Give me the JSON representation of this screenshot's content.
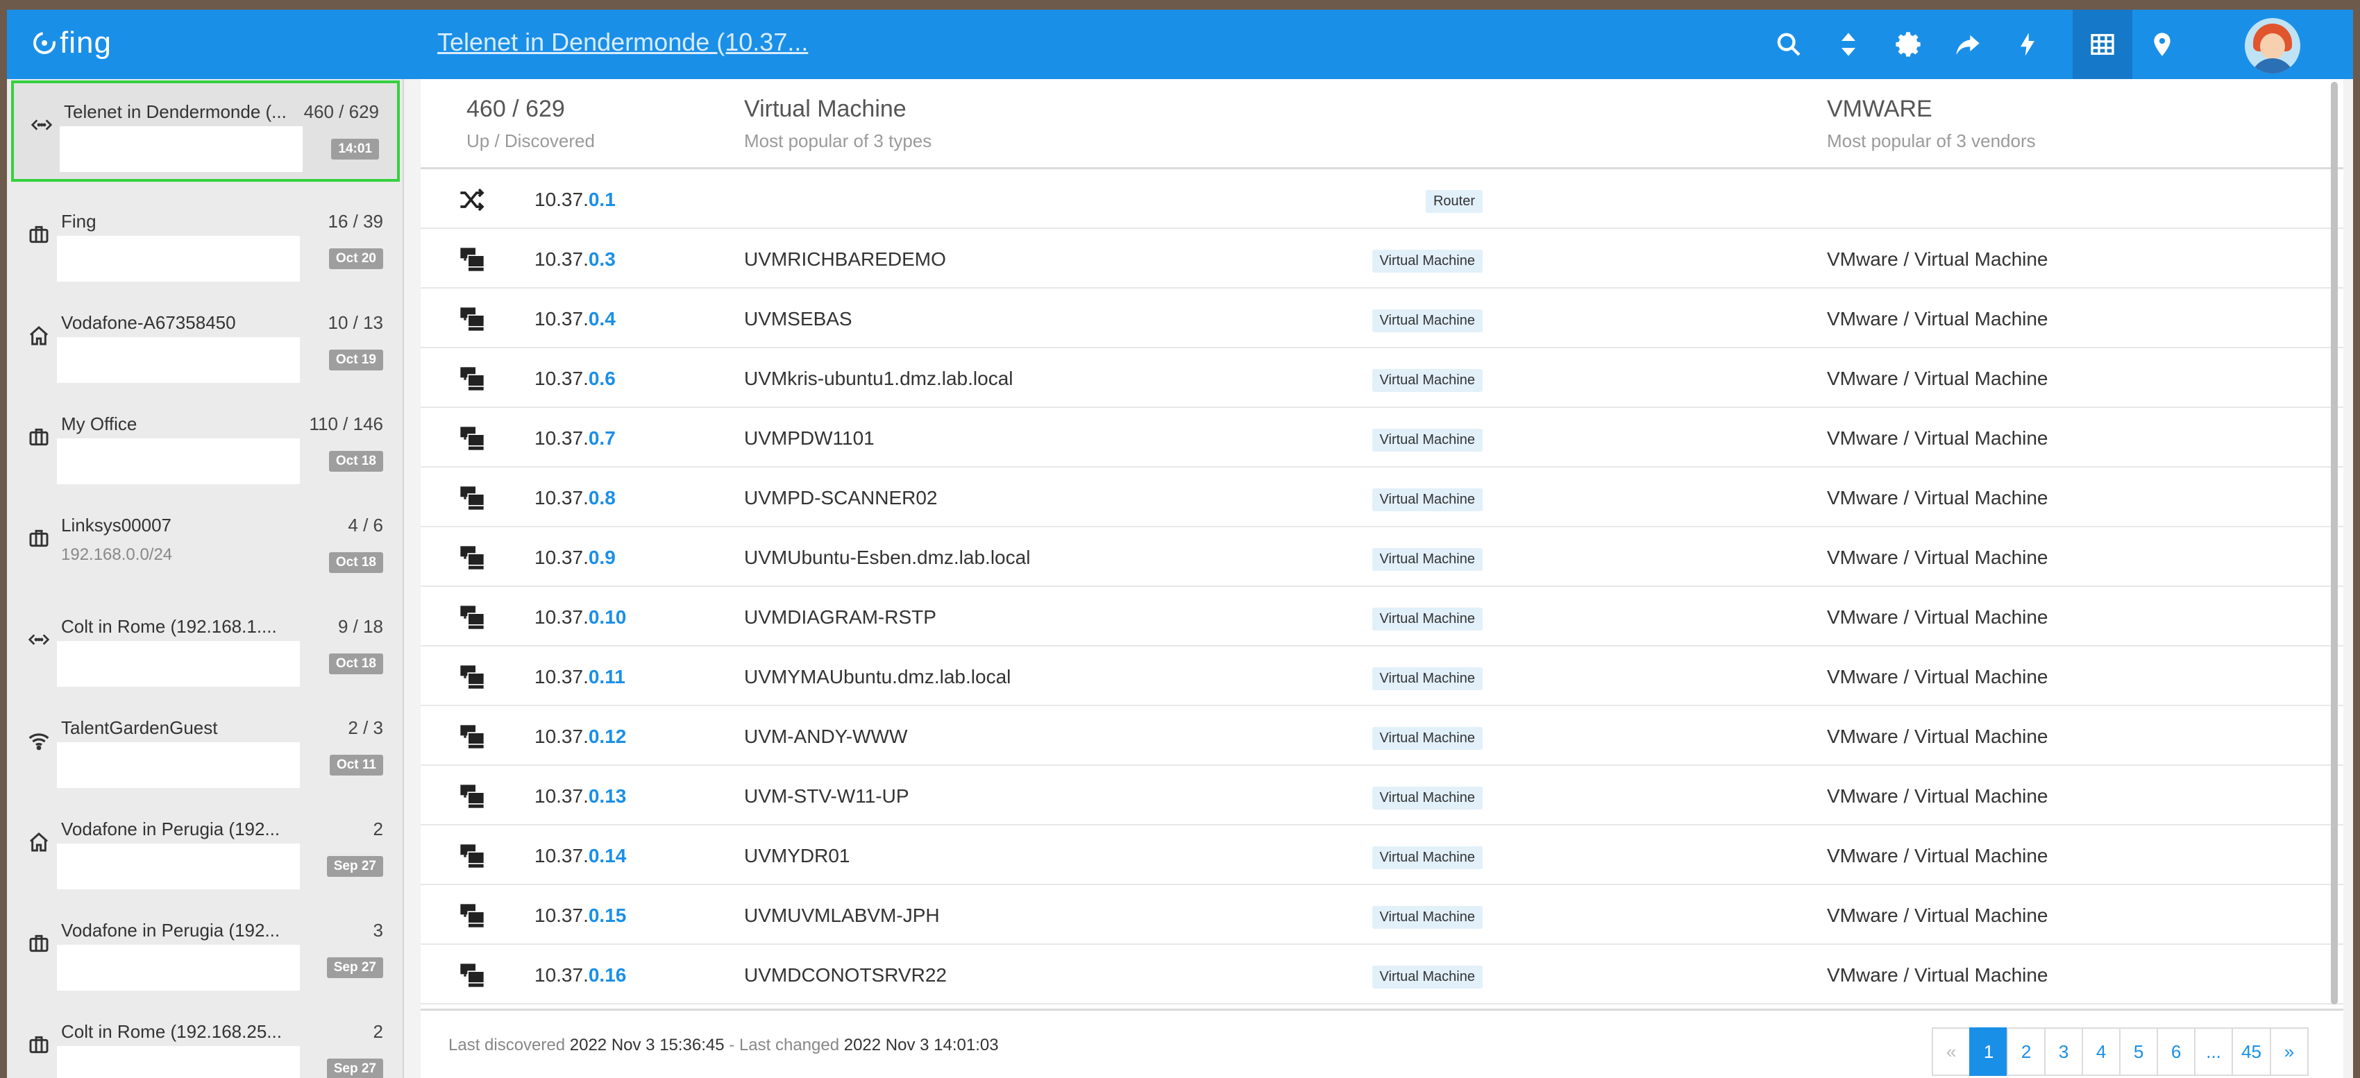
{
  "app": {
    "logo_text": "fing",
    "network_title": "Telenet in Dendermonde (10.37..."
  },
  "toolbar": {
    "search": "search-icon",
    "sort": "sort-icon",
    "settings": "gear-icon",
    "share": "share-icon",
    "bolt": "bolt-icon",
    "grid": "grid-icon",
    "location": "location-pin-icon"
  },
  "sidebar": {
    "items": [
      {
        "name": "Telenet in Dendermonde (...",
        "count": "460 / 629",
        "sub": "",
        "date": "14:01",
        "icon": "ethernet"
      },
      {
        "name": "Fing",
        "count": "16 / 39",
        "sub": "",
        "date": "Oct 20",
        "icon": "briefcase"
      },
      {
        "name": "Vodafone-A67358450",
        "count": "10 / 13",
        "sub": "",
        "date": "Oct 19",
        "icon": "home"
      },
      {
        "name": "My Office",
        "count": "110 / 146",
        "sub": "",
        "date": "Oct 18",
        "icon": "briefcase"
      },
      {
        "name": "Linksys00007",
        "count": "4 / 6",
        "sub": "192.168.0.0/24",
        "date": "Oct 18",
        "icon": "briefcase"
      },
      {
        "name": "Colt in Rome (192.168.1....",
        "count": "9 / 18",
        "sub": "",
        "date": "Oct 18",
        "icon": "ethernet"
      },
      {
        "name": "TalentGardenGuest",
        "count": "2 / 3",
        "sub": "",
        "date": "Oct 11",
        "icon": "wifi"
      },
      {
        "name": "Vodafone in Perugia (192...",
        "count": "2",
        "sub": "",
        "date": "Sep 27",
        "icon": "home"
      },
      {
        "name": "Vodafone in Perugia (192...",
        "count": "3",
        "sub": "",
        "date": "Sep 27",
        "icon": "briefcase"
      },
      {
        "name": "Colt in Rome (192.168.25...",
        "count": "2",
        "sub": "",
        "date": "Sep 27",
        "icon": "briefcase"
      }
    ]
  },
  "summary": {
    "devices_value": "460 / 629",
    "devices_label": "Up / Discovered",
    "type_value": "Virtual Machine",
    "type_label": "Most popular of 3 types",
    "vendor_value": "VMWARE",
    "vendor_label": "Most popular of 3 vendors"
  },
  "devices": [
    {
      "ip_prefix": "10.37.",
      "ip_host": "0.1",
      "name": "",
      "type": "Router",
      "vendor": "",
      "icon": "router"
    },
    {
      "ip_prefix": "10.37.",
      "ip_host": "0.3",
      "name": "UVMRICHBAREDEMO",
      "type": "Virtual Machine",
      "vendor": "VMware / Virtual Machine",
      "icon": "vm"
    },
    {
      "ip_prefix": "10.37.",
      "ip_host": "0.4",
      "name": "UVMSEBAS",
      "type": "Virtual Machine",
      "vendor": "VMware / Virtual Machine",
      "icon": "vm"
    },
    {
      "ip_prefix": "10.37.",
      "ip_host": "0.6",
      "name": "UVMkris-ubuntu1.dmz.lab.local",
      "type": "Virtual Machine",
      "vendor": "VMware / Virtual Machine",
      "icon": "vm"
    },
    {
      "ip_prefix": "10.37.",
      "ip_host": "0.7",
      "name": "UVMPDW1101",
      "type": "Virtual Machine",
      "vendor": "VMware / Virtual Machine",
      "icon": "vm"
    },
    {
      "ip_prefix": "10.37.",
      "ip_host": "0.8",
      "name": "UVMPD-SCANNER02",
      "type": "Virtual Machine",
      "vendor": "VMware / Virtual Machine",
      "icon": "vm"
    },
    {
      "ip_prefix": "10.37.",
      "ip_host": "0.9",
      "name": "UVMUbuntu-Esben.dmz.lab.local",
      "type": "Virtual Machine",
      "vendor": "VMware / Virtual Machine",
      "icon": "vm"
    },
    {
      "ip_prefix": "10.37.",
      "ip_host": "0.10",
      "name": "UVMDIAGRAM-RSTP",
      "type": "Virtual Machine",
      "vendor": "VMware / Virtual Machine",
      "icon": "vm"
    },
    {
      "ip_prefix": "10.37.",
      "ip_host": "0.11",
      "name": "UVMYMAUbuntu.dmz.lab.local",
      "type": "Virtual Machine",
      "vendor": "VMware / Virtual Machine",
      "icon": "vm"
    },
    {
      "ip_prefix": "10.37.",
      "ip_host": "0.12",
      "name": "UVM-ANDY-WWW",
      "type": "Virtual Machine",
      "vendor": "VMware / Virtual Machine",
      "icon": "vm"
    },
    {
      "ip_prefix": "10.37.",
      "ip_host": "0.13",
      "name": "UVM-STV-W11-UP",
      "type": "Virtual Machine",
      "vendor": "VMware / Virtual Machine",
      "icon": "vm"
    },
    {
      "ip_prefix": "10.37.",
      "ip_host": "0.14",
      "name": "UVMYDR01",
      "type": "Virtual Machine",
      "vendor": "VMware / Virtual Machine",
      "icon": "vm"
    },
    {
      "ip_prefix": "10.37.",
      "ip_host": "0.15",
      "name": "UVMUVMLABVM-JPH",
      "type": "Virtual Machine",
      "vendor": "VMware / Virtual Machine",
      "icon": "vm"
    },
    {
      "ip_prefix": "10.37.",
      "ip_host": "0.16",
      "name": "UVMDCONOTSRVR22",
      "type": "Virtual Machine",
      "vendor": "VMware / Virtual Machine",
      "icon": "vm"
    }
  ],
  "footer": {
    "last_discovered_label": "Last discovered",
    "last_discovered_value": "2022 Nov 3 15:36:45",
    "separator": " - ",
    "last_changed_label": "Last changed",
    "last_changed_value": "2022 Nov 3 14:01:03"
  },
  "pagination": {
    "prev": "«",
    "pages": [
      "1",
      "2",
      "3",
      "4",
      "5",
      "6",
      "...",
      "45"
    ],
    "next": "»",
    "active": "1"
  },
  "colors": {
    "accent": "#1a8fe8",
    "selection": "#35d13f",
    "badge": "#9e9e9e",
    "type_chip": "#e2f0fa"
  }
}
